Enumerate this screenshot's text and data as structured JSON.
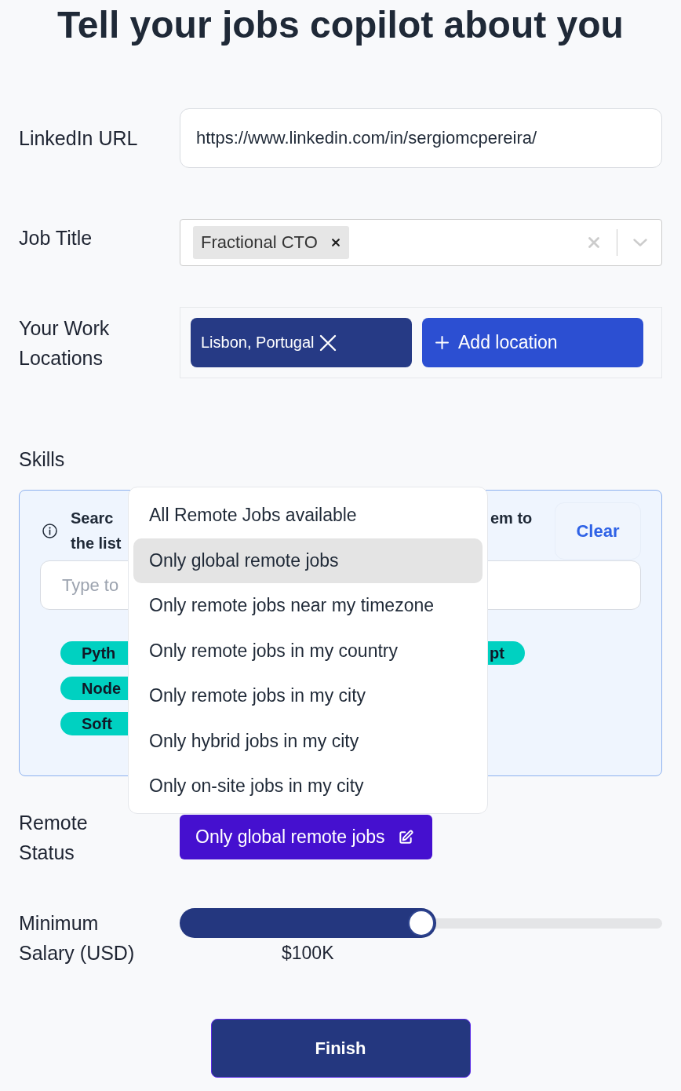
{
  "title": "Tell your jobs copilot about you",
  "linkedin": {
    "label": "LinkedIn URL",
    "value": "https://www.linkedin.com/in/sergiomcpereira/"
  },
  "job_title": {
    "label": "Job Title",
    "tags": [
      "Fractional CTO"
    ]
  },
  "locations": {
    "label": "Your Work Locations",
    "items": [
      "Lisbon, Portugal"
    ],
    "add_button": "Add location"
  },
  "skills": {
    "label": "Skills",
    "hint_left": [
      "Searc",
      "the list"
    ],
    "hint_right": "em to",
    "clear_button": "Clear",
    "search": {
      "placeholder": "Type to"
    },
    "tags_left": [
      "Pyth",
      "Node",
      "Soft"
    ],
    "tags_right": [
      "pt"
    ]
  },
  "remote_status": {
    "label": "Remote Status",
    "value": "Only global remote jobs",
    "expanded": true,
    "options": [
      {
        "label": "All Remote Jobs available",
        "selected": false
      },
      {
        "label": "Only global remote jobs",
        "selected": true
      },
      {
        "label": "Only remote jobs near my timezone",
        "selected": false
      },
      {
        "label": "Only remote jobs in my country",
        "selected": false
      },
      {
        "label": "Only remote jobs in my city",
        "selected": false
      },
      {
        "label": "Only hybrid jobs in my city",
        "selected": false
      },
      {
        "label": "Only on-site jobs in my city",
        "selected": false
      }
    ]
  },
  "salary": {
    "label": "Minimum Salary (USD)",
    "level": 0.5,
    "reading": "$100K"
  },
  "finish_button": "Finish"
}
